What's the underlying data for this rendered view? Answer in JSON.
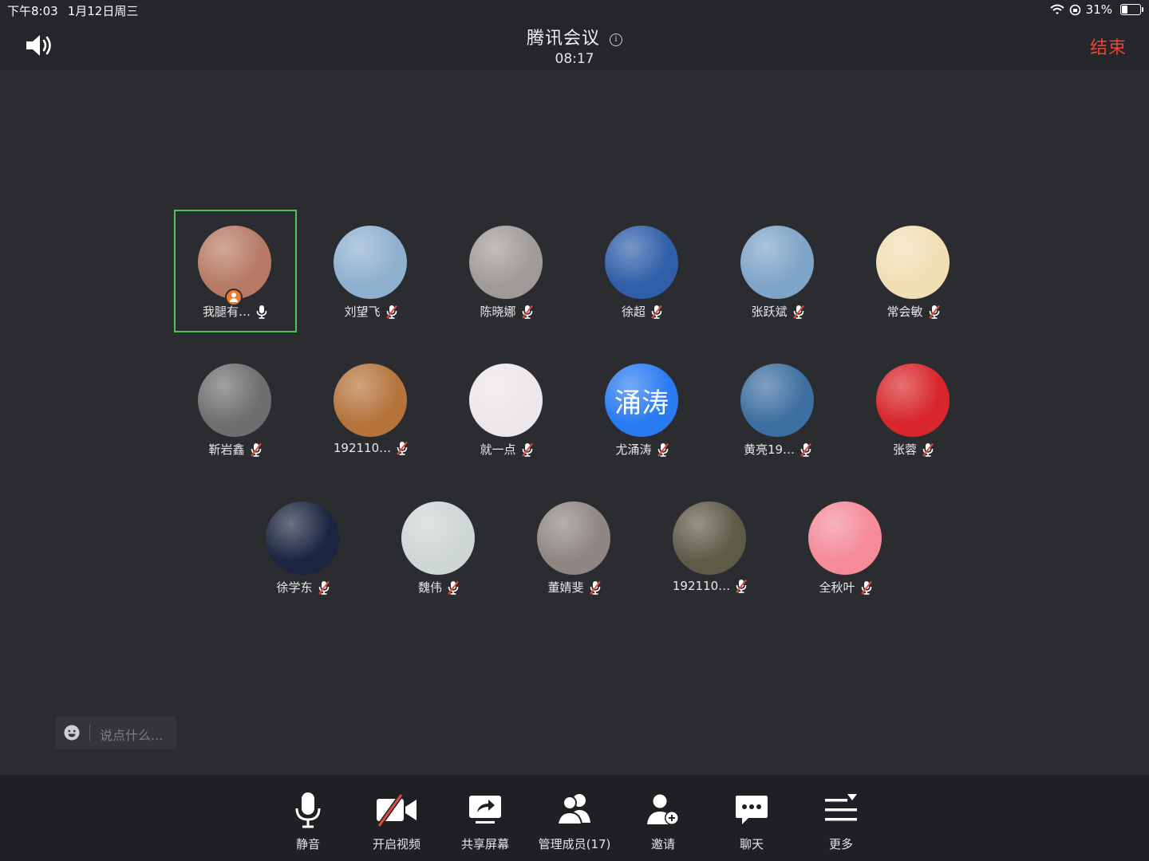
{
  "status_bar": {
    "time": "下午8:03",
    "date": "1月12日周三",
    "battery": "31%",
    "battery_level": 0.31
  },
  "header": {
    "title": "腾讯会议",
    "timer": "08:17",
    "end_label": "结束"
  },
  "participants": [
    {
      "name": "我腿有…",
      "mic_on": true,
      "is_host": true,
      "active": true,
      "avatar_color": "#b77a64"
    },
    {
      "name": "刘望飞",
      "mic_on": false,
      "avatar_color": "#8fb0cf"
    },
    {
      "name": "陈晓娜",
      "mic_on": false,
      "avatar_color": "#a09b98"
    },
    {
      "name": "徐超",
      "mic_on": false,
      "avatar_color": "#2f5fa8"
    },
    {
      "name": "张跃斌",
      "mic_on": false,
      "avatar_color": "#7ea4c8"
    },
    {
      "name": "常会敏",
      "mic_on": false,
      "avatar_color": "#f1deb4"
    },
    {
      "name": "靳岩鑫",
      "mic_on": false,
      "avatar_color": "#6e6e6e"
    },
    {
      "name": "192110…",
      "mic_on": false,
      "avatar_color": "#b5743c"
    },
    {
      "name": "就一点",
      "mic_on": false,
      "avatar_color": "#ece7ea"
    },
    {
      "name": "尤涌涛",
      "mic_on": false,
      "avatar_color": "#2a7bf2",
      "avatar_text": "涌涛"
    },
    {
      "name": "黄亮19…",
      "mic_on": false,
      "avatar_color": "#3d6fa0"
    },
    {
      "name": "张蓉",
      "mic_on": false,
      "avatar_color": "#d8262a"
    },
    {
      "name": "徐学东",
      "mic_on": false,
      "avatar_color": "#1b2540"
    },
    {
      "name": "魏伟",
      "mic_on": false,
      "avatar_color": "#cfd6d6"
    },
    {
      "name": "董婧斐",
      "mic_on": false,
      "avatar_color": "#8e8682"
    },
    {
      "name": "192110…",
      "mic_on": false,
      "avatar_color": "#5e5a48"
    },
    {
      "name": "全秋叶",
      "mic_on": false,
      "avatar_color": "#f48a9a"
    }
  ],
  "chat": {
    "placeholder": "说点什么..."
  },
  "toolbar": [
    {
      "id": "mute",
      "label": "静音",
      "icon": "mic-icon"
    },
    {
      "id": "video",
      "label": "开启视频",
      "icon": "video-off-icon"
    },
    {
      "id": "share",
      "label": "共享屏幕",
      "icon": "share-screen-icon"
    },
    {
      "id": "members",
      "label": "管理成员(17)",
      "icon": "members-icon"
    },
    {
      "id": "invite",
      "label": "邀请",
      "icon": "invite-icon"
    },
    {
      "id": "chat",
      "label": "聊天",
      "icon": "chat-icon"
    },
    {
      "id": "more",
      "label": "更多",
      "icon": "more-icon"
    }
  ],
  "colors": {
    "background": "#2b2c30",
    "bar": "#25262a",
    "toolbar": "#1f2023",
    "end": "#e8453c",
    "active_border": "#4fc35a",
    "muted": "#e04a3c"
  }
}
